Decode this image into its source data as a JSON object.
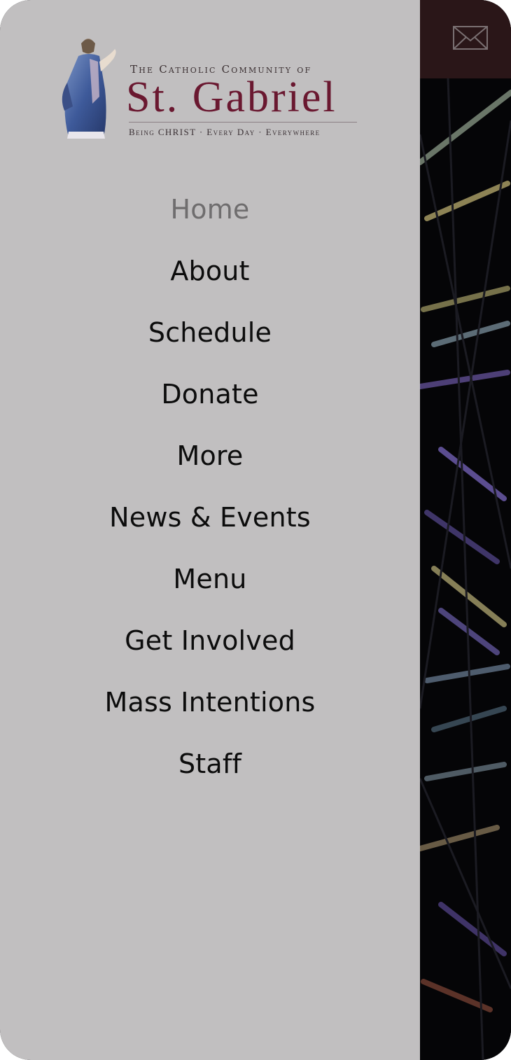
{
  "logo": {
    "top_line": "The Catholic Community of",
    "name": "St. Gabriel",
    "tagline": "Being CHRIST · Every Day · Everywhere",
    "accent_color": "#6a1830"
  },
  "nav": {
    "items": [
      {
        "label": "Home",
        "active": true
      },
      {
        "label": "About"
      },
      {
        "label": "Schedule"
      },
      {
        "label": "Donate"
      },
      {
        "label": "More"
      },
      {
        "label": "News & Events"
      },
      {
        "label": "Menu"
      },
      {
        "label": "Get Involved"
      },
      {
        "label": "Mass Intentions"
      },
      {
        "label": "Staff"
      }
    ]
  },
  "header": {
    "icon": "envelope-icon",
    "background_color": "#2a1618"
  },
  "drawer": {
    "background_color": "#c1bfc0"
  }
}
